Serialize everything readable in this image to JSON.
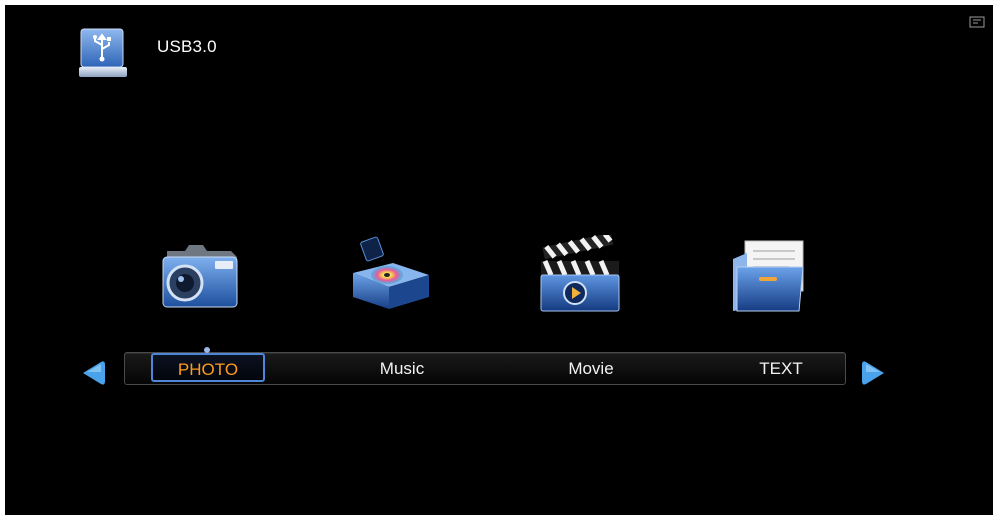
{
  "device": {
    "label": "USB3.0",
    "icon": "usb-drive-icon"
  },
  "corner_icon": "settings-small-icon",
  "menu": {
    "items": [
      {
        "label": "PHOTO",
        "icon": "camera-icon",
        "selected": true
      },
      {
        "label": "Music",
        "icon": "music-player-icon",
        "selected": false
      },
      {
        "label": "Movie",
        "icon": "clapperboard-icon",
        "selected": false
      },
      {
        "label": "TEXT",
        "icon": "document-folder-icon",
        "selected": false
      }
    ],
    "selected_color": "#ff9b1f",
    "highlight_border": "#4f86d8"
  },
  "nav": {
    "left_icon": "arrow-left-icon",
    "right_icon": "arrow-right-icon"
  },
  "colors": {
    "background": "#000000",
    "text": "#ffffff",
    "accent_blue": "#3f7fd0"
  }
}
